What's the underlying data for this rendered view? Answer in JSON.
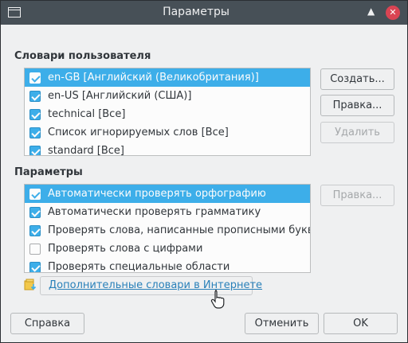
{
  "titlebar": {
    "title": "Параметры",
    "up_glyph": "▲",
    "close_glyph": "✕"
  },
  "dictionaries": {
    "label": "Словари пользователя",
    "items": [
      {
        "label": "en-GB [Английский (Великобритания)]",
        "checked": true,
        "selected": true
      },
      {
        "label": "en-US [Английский (США)]",
        "checked": true,
        "selected": false
      },
      {
        "label": "technical [Все]",
        "checked": true,
        "selected": false
      },
      {
        "label": "Список игнорируемых слов [Все]",
        "checked": true,
        "selected": false
      },
      {
        "label": "standard [Все]",
        "checked": true,
        "selected": false
      }
    ],
    "buttons": {
      "create": "Создать...",
      "edit": "Правка...",
      "delete": "Удалить"
    }
  },
  "options": {
    "label": "Параметры",
    "items": [
      {
        "label": "Автоматически проверять орфографию",
        "checked": true,
        "selected": true
      },
      {
        "label": "Автоматически проверять грамматику",
        "checked": true,
        "selected": false
      },
      {
        "label": "Проверять слова, написанные прописными буквами",
        "checked": true,
        "selected": false
      },
      {
        "label": "Проверять слова с цифрами",
        "checked": false,
        "selected": false
      },
      {
        "label": "Проверять специальные области",
        "checked": true,
        "selected": false
      }
    ],
    "buttons": {
      "edit": "Правка..."
    }
  },
  "link": {
    "label": "Дополнительные словари в Интернете"
  },
  "footer": {
    "help": "Справка",
    "cancel": "Отменить",
    "ok": "OK"
  },
  "colors": {
    "accent": "#3daee9",
    "titlebar": "#475057",
    "close": "#da4453",
    "link": "#2980b9"
  },
  "icons": {
    "app": "window-icon",
    "link": "dictionary-download-icon",
    "cursor": "hand-pointer-icon"
  }
}
